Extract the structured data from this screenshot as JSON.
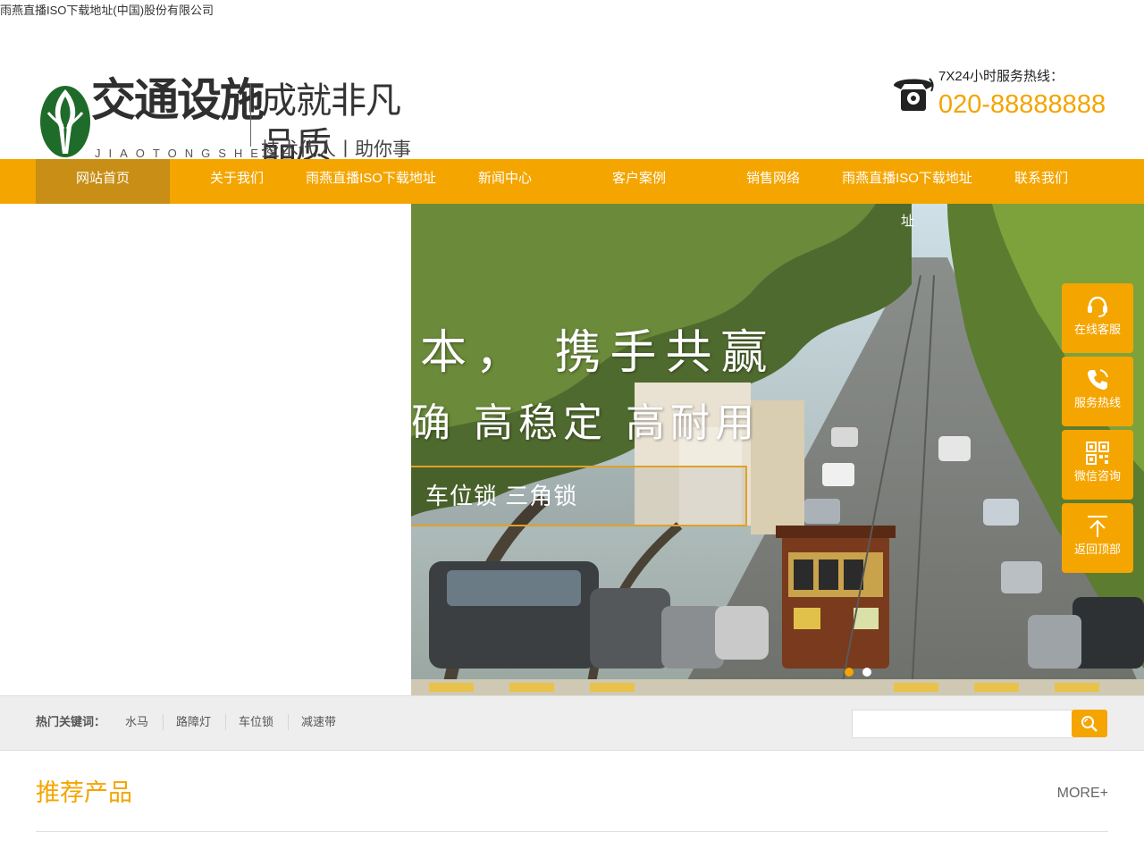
{
  "site_title": "雨燕直播ISO下载地址(中国)股份有限公司",
  "logo": {
    "name": "交通设施",
    "pinyin": "JIAOTONGSHESHI",
    "slogan": "成就非凡品质",
    "sub_slogan": "技术代人丨助你事半功倍"
  },
  "hotline": {
    "label": "7X24小时服务热线：",
    "number": "020-88888888"
  },
  "nav": {
    "items": [
      {
        "label": "网站首页"
      },
      {
        "label": "关于我们"
      },
      {
        "label": "雨燕直播ISO下载地址"
      },
      {
        "label": "新闻中心"
      },
      {
        "label": "客户案例"
      },
      {
        "label": "销售网络"
      },
      {
        "label": "雨燕直播ISO下载地址"
      },
      {
        "label": "联系我们"
      }
    ]
  },
  "banner": {
    "line1": "本， 携手共赢",
    "line2": "确 高稳定 高耐用",
    "box_text": "车位锁 三角锁",
    "corner_text": "址"
  },
  "side_tools": [
    {
      "label": "在线客服",
      "icon": "headset-icon"
    },
    {
      "label": "服务热线",
      "icon": "phone-icon"
    },
    {
      "label": "微信咨询",
      "icon": "qrcode-icon"
    },
    {
      "label": "返回顶部",
      "icon": "arrow-up-icon"
    }
  ],
  "keywords": {
    "label": "热门关键词：",
    "items": [
      "水马",
      "路障灯",
      "车位锁",
      "减速带"
    ]
  },
  "search": {
    "value": "",
    "placeholder": ""
  },
  "products": {
    "title": "推荐产品",
    "more": "MORE+"
  },
  "colors": {
    "accent": "#f5a500",
    "nav_active": "#c88e15"
  }
}
